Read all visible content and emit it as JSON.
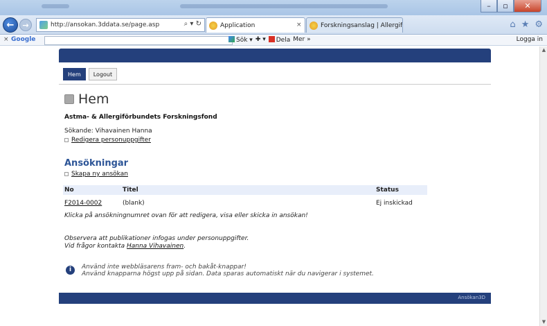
{
  "browser": {
    "url": "http://ansokan.3ddata.se/page.asp",
    "tabs": [
      {
        "label": "Application",
        "active": true
      },
      {
        "label": "Forskningsanslag | Allergiforsk...",
        "active": false
      }
    ],
    "toolbar": {
      "close": "×",
      "search_brand": "Google",
      "sok": "Sök ▾",
      "dela": "Dela",
      "mer": "Mer »",
      "login": "Logga in"
    }
  },
  "page": {
    "menu": [
      {
        "label": "Hem",
        "active": true
      },
      {
        "label": "Logout",
        "active": false
      }
    ],
    "title": "Hem",
    "organization": "Astma- & Allergiförbundets Forskningsfond",
    "applicant": "Sökande: Vihavainen Hanna",
    "edit_link": "Redigera personuppgifter",
    "section_title": "Ansökningar",
    "create_link": "Skapa ny ansökan",
    "table": {
      "headers": {
        "no": "No",
        "title": "Titel",
        "status": "Status"
      },
      "rows": [
        {
          "no": "F2014-0002",
          "title": "(blank)",
          "status": "Ej inskickad"
        }
      ]
    },
    "hint": "Klicka på ansökningnumret ovan för att redigera, visa eller skicka in ansökan!",
    "note_line1": "Observera att publikationer infogas under personuppgifter.",
    "note_line2_prefix": "Vid frågor kontakta ",
    "note_contact": "Hanna Vihavainen",
    "note_line2_suffix": ".",
    "info_line1": "Använd inte webbläsarens fram- och bakåt-knappar!",
    "info_line2": "Använd knapparna högst upp på sidan. Data sparas automatiskt när du navigerar i systemet.",
    "footer_brand": "Ansökan3D"
  },
  "colors": {
    "accent": "#24407c",
    "table_header": "#e8eefa",
    "section_title": "#2d5597"
  }
}
